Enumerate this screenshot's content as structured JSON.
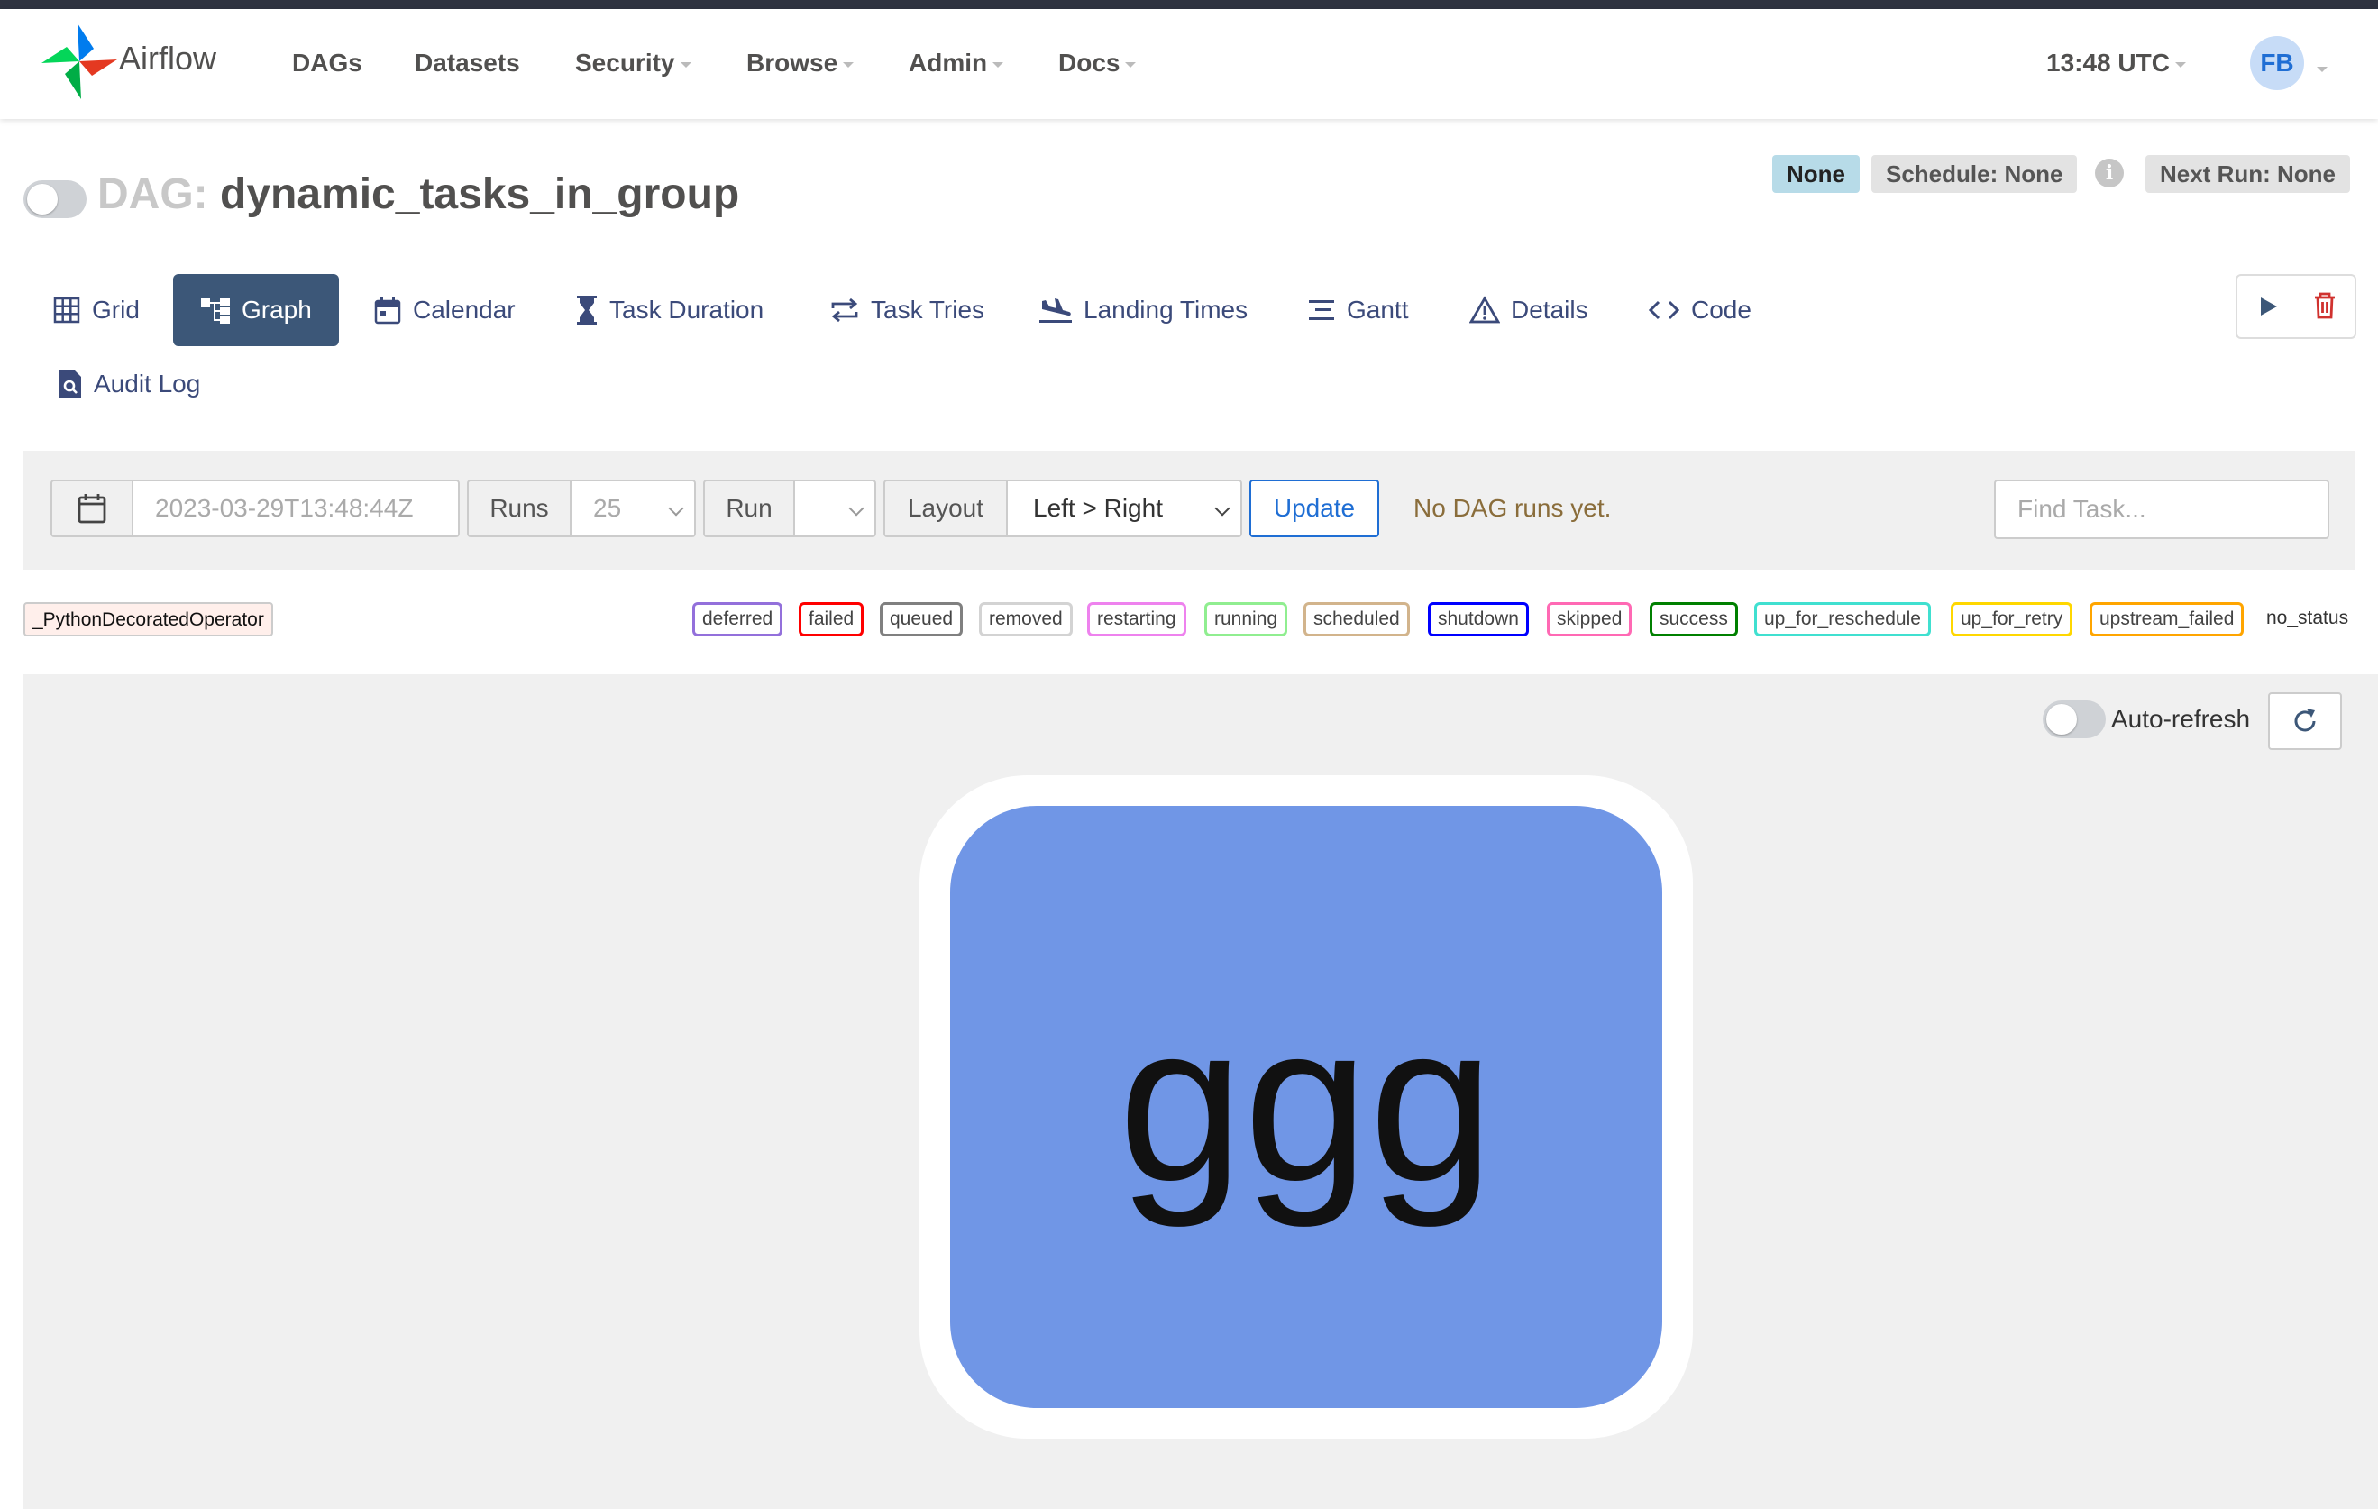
{
  "brand": {
    "name": "Airflow"
  },
  "nav": {
    "items": [
      {
        "label": "DAGs",
        "has_menu": false
      },
      {
        "label": "Datasets",
        "has_menu": false
      },
      {
        "label": "Security",
        "has_menu": true
      },
      {
        "label": "Browse",
        "has_menu": true
      },
      {
        "label": "Admin",
        "has_menu": true
      },
      {
        "label": "Docs",
        "has_menu": true
      }
    ],
    "clock": "13:48 UTC",
    "user_initials": "FB"
  },
  "dag": {
    "title_prefix": "DAG:",
    "name": "dynamic_tasks_in_group",
    "paused": true
  },
  "badges": {
    "state": "None",
    "schedule": "Schedule: None",
    "info": "i",
    "next_run": "Next Run: None"
  },
  "tabs": [
    {
      "label": "Grid",
      "icon": "grid-icon",
      "active": false
    },
    {
      "label": "Graph",
      "icon": "graph-icon",
      "active": true
    },
    {
      "label": "Calendar",
      "icon": "calendar-icon",
      "active": false
    },
    {
      "label": "Task Duration",
      "icon": "hourglass-icon",
      "active": false
    },
    {
      "label": "Task Tries",
      "icon": "retry-arrows-icon",
      "active": false
    },
    {
      "label": "Landing Times",
      "icon": "plane-landing-icon",
      "active": false
    },
    {
      "label": "Gantt",
      "icon": "gantt-icon",
      "active": false
    },
    {
      "label": "Details",
      "icon": "warning-triangle-icon",
      "active": false
    },
    {
      "label": "Code",
      "icon": "code-icon",
      "active": false
    },
    {
      "label": "Audit Log",
      "icon": "file-search-icon",
      "active": false
    }
  ],
  "toolbar": {
    "date_placeholder": "2023-03-29T13:48:44Z",
    "runs_label": "Runs",
    "runs_value": "25",
    "run_label": "Run",
    "run_value": "",
    "layout_label": "Layout",
    "layout_value": "Left > Right",
    "update_label": "Update",
    "status_message": "No DAG runs yet.",
    "find_placeholder": "Find Task..."
  },
  "legend": {
    "operator": {
      "label": "_PythonDecoratedOperator",
      "color": "#ffefeb"
    },
    "states": [
      {
        "label": "deferred",
        "color": "#9370db"
      },
      {
        "label": "failed",
        "color": "#ff0000"
      },
      {
        "label": "queued",
        "color": "#808080"
      },
      {
        "label": "removed",
        "color": "#d3d3d3"
      },
      {
        "label": "restarting",
        "color": "#ee82ee"
      },
      {
        "label": "running",
        "color": "#90ee90"
      },
      {
        "label": "scheduled",
        "color": "#d2b48c"
      },
      {
        "label": "shutdown",
        "color": "#0000ff"
      },
      {
        "label": "skipped",
        "color": "#ff69b4"
      },
      {
        "label": "success",
        "color": "#008000"
      },
      {
        "label": "up_for_reschedule",
        "color": "#40e0d0"
      },
      {
        "label": "up_for_retry",
        "color": "#ffd700"
      },
      {
        "label": "upstream_failed",
        "color": "#ffa500"
      }
    ],
    "no_status": "no_status"
  },
  "graph": {
    "auto_refresh_label": "Auto-refresh",
    "auto_refresh_on": false,
    "node": {
      "label": "ggg",
      "color": "#7096e6"
    }
  },
  "colors": {
    "accent": "#3c5778",
    "link": "#1f6ed4"
  }
}
